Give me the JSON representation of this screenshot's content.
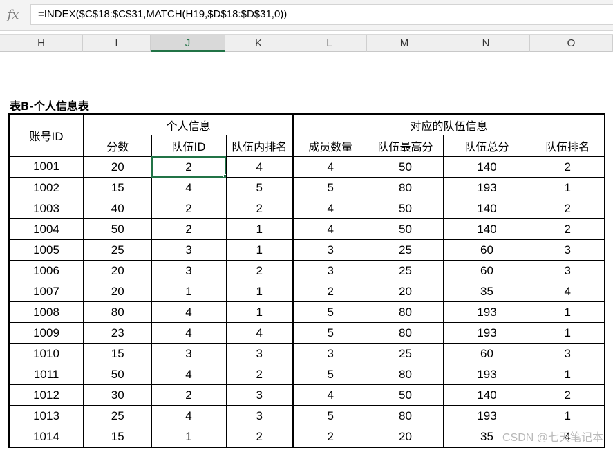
{
  "formula_bar": {
    "fx_label": "fx",
    "formula": "=INDEX($C$18:$C$31,MATCH(H19,$D$18:$D$31,0))"
  },
  "columns": [
    "H",
    "I",
    "J",
    "K",
    "L",
    "M",
    "N",
    "O"
  ],
  "active_column": "J",
  "table": {
    "title": "表B-个人信息表",
    "account_header": "账号ID",
    "group_personal": "个人信息",
    "group_team": "对应的队伍信息",
    "subheaders": [
      "分数",
      "队伍ID",
      "队伍内排名",
      "成员数量",
      "队伍最高分",
      "队伍总分",
      "队伍排名"
    ],
    "rows": [
      [
        "1001",
        "20",
        "2",
        "4",
        "4",
        "50",
        "140",
        "2"
      ],
      [
        "1002",
        "15",
        "4",
        "5",
        "5",
        "80",
        "193",
        "1"
      ],
      [
        "1003",
        "40",
        "2",
        "2",
        "4",
        "50",
        "140",
        "2"
      ],
      [
        "1004",
        "50",
        "2",
        "1",
        "4",
        "50",
        "140",
        "2"
      ],
      [
        "1005",
        "25",
        "3",
        "1",
        "3",
        "25",
        "60",
        "3"
      ],
      [
        "1006",
        "20",
        "3",
        "2",
        "3",
        "25",
        "60",
        "3"
      ],
      [
        "1007",
        "20",
        "1",
        "1",
        "2",
        "20",
        "35",
        "4"
      ],
      [
        "1008",
        "80",
        "4",
        "1",
        "5",
        "80",
        "193",
        "1"
      ],
      [
        "1009",
        "23",
        "4",
        "4",
        "5",
        "80",
        "193",
        "1"
      ],
      [
        "1010",
        "15",
        "3",
        "3",
        "3",
        "25",
        "60",
        "3"
      ],
      [
        "1011",
        "50",
        "4",
        "2",
        "5",
        "80",
        "193",
        "1"
      ],
      [
        "1012",
        "30",
        "2",
        "3",
        "4",
        "50",
        "140",
        "2"
      ],
      [
        "1013",
        "25",
        "4",
        "3",
        "5",
        "80",
        "193",
        "1"
      ],
      [
        "1014",
        "15",
        "1",
        "2",
        "2",
        "20",
        "35",
        "4"
      ]
    ],
    "selected_cell": {
      "row": 0,
      "col": 2
    }
  },
  "watermark": "CSDN @七天笔记本",
  "colors": {
    "selection": "#217346",
    "header_bg": "#efefef"
  }
}
